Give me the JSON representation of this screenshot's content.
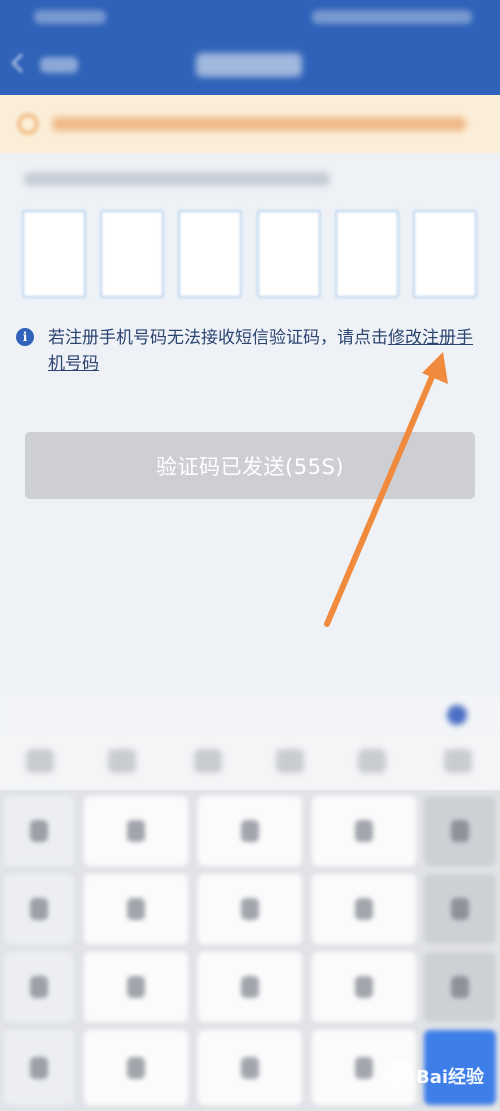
{
  "info": {
    "message": "若注册手机号码无法接收短信验证码，请点击",
    "link_label": "修改注册手机号码",
    "icon": "info-icon"
  },
  "send_button": {
    "label": "验证码已发送(55S)",
    "state": "disabled"
  },
  "code_input": {
    "box_count": 6,
    "values": [
      "",
      "",
      "",
      "",
      "",
      ""
    ]
  },
  "annotation": {
    "color": "#f08a3c",
    "points_to": "修改注册手机号码"
  },
  "colors": {
    "brand_blue": "#2f62b8",
    "link_text": "#2b4470",
    "notice_background": "#fbeed8",
    "button_disabled": "#cdcfd3"
  },
  "watermark": {
    "text": "Bai经验"
  }
}
